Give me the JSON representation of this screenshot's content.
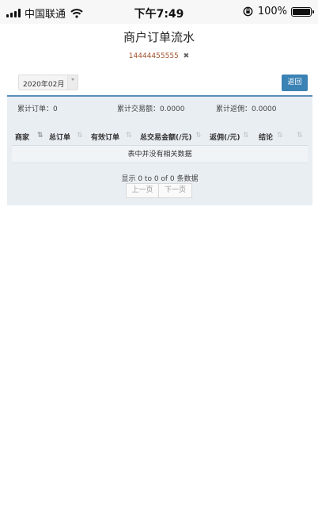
{
  "status_bar": {
    "carrier": "中国联通",
    "time": "下午7:49",
    "battery": "100%",
    "battery_level": 1.0
  },
  "header": {
    "title": "商户订单流水",
    "account": "14444455555",
    "account_close": "✖"
  },
  "filters": {
    "month": "2020年02月",
    "back_label": "返回"
  },
  "summary": {
    "orders": "累计订单：0",
    "amount": "累计交易额：0.0000",
    "commission": "累计返佣：0.0000"
  },
  "table": {
    "columns": [
      "商家",
      "总订单",
      "有效订单",
      "总交易金额(/元)",
      "返佣(/元)",
      "结论"
    ],
    "empty_text": "表中并没有相关数据"
  },
  "pagination": {
    "info": "显示 0 to 0 of 0 条数据",
    "prev": "上一页",
    "next": "下一页"
  },
  "colors": {
    "accent": "#3b82b5",
    "panel_bg": "#e9eef3",
    "account_text": "#a0522d"
  }
}
